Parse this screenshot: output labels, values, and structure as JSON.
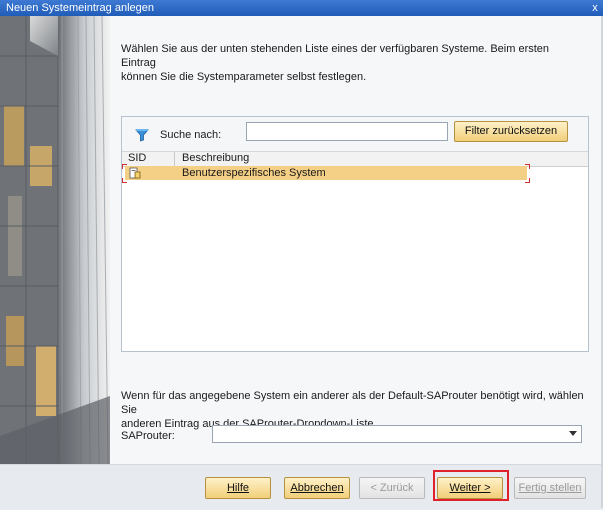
{
  "window": {
    "title": "Neuen Systemeintrag anlegen",
    "close_label": "x"
  },
  "intro": {
    "line1": "Wählen Sie aus der unten stehenden Liste eines der verfügbaren Systeme. Beim ersten Eintrag",
    "line2": "können Sie die Systemparameter selbst festlegen."
  },
  "search": {
    "label": "Suche nach:",
    "value": "",
    "reset_label": "Filter zurücksetzen"
  },
  "list": {
    "columns": [
      "SID",
      "Beschreibung"
    ],
    "rows": [
      {
        "sid": "",
        "description": "Benutzerspezifisches System",
        "selected": true
      }
    ]
  },
  "router": {
    "info_line1": "Wenn für das angegebene System ein anderer als der Default-SAProuter benötigt wird, wählen Sie",
    "info_line2": "anderen Eintrag aus der SAProuter-Dropdown-Liste.",
    "label": "SAProuter:",
    "value": ""
  },
  "footer": {
    "help": "Hilfe",
    "cancel": "Abbrechen",
    "back": "< Zurück",
    "next": "Weiter >",
    "finish": "Fertig stellen"
  },
  "colors": {
    "title_bar": "#2c69c6",
    "selection": "#f4cf86",
    "button_gold": "#f1cf7a",
    "highlight_box": "#e0202a"
  }
}
